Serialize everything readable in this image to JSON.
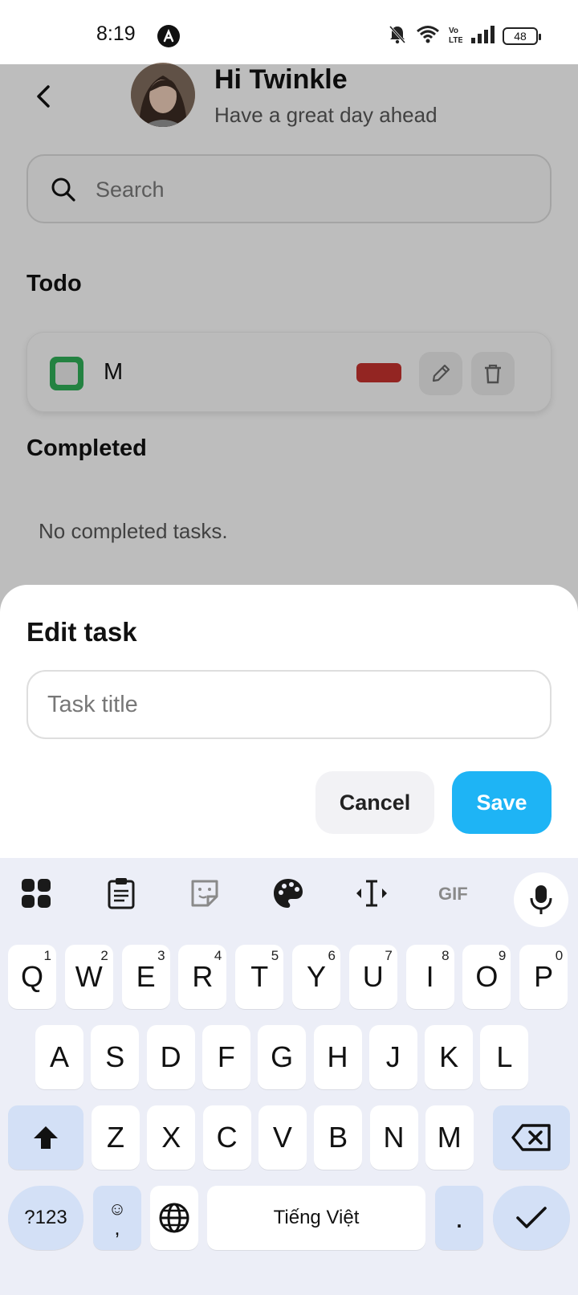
{
  "status_bar": {
    "time": "8:19",
    "battery": "48",
    "icons": [
      "app-logo-icon",
      "bell-off-icon",
      "wifi-icon",
      "volte-icon",
      "signal-icon",
      "battery-icon"
    ]
  },
  "header": {
    "greeting": "Hi Twinkle",
    "subtitle": "Have a great day ahead"
  },
  "search": {
    "placeholder": "Search"
  },
  "todo": {
    "section_title": "Todo",
    "tasks": [
      {
        "title": "M",
        "color": "#c0312d"
      }
    ]
  },
  "completed": {
    "section_title": "Completed",
    "empty_text": "No completed tasks."
  },
  "edit_sheet": {
    "title": "Edit task",
    "input_placeholder": "Task title",
    "input_value": "",
    "cancel_label": "Cancel",
    "save_label": "Save",
    "save_color": "#1eb4f5"
  },
  "keyboard": {
    "toolbar_icons": [
      "apps-grid-icon",
      "clipboard-icon",
      "sticker-icon",
      "palette-icon",
      "text-cursor-icon",
      "gif-icon",
      "mic-icon"
    ],
    "gif_label": "GIF",
    "row1": [
      {
        "k": "Q",
        "n": "1"
      },
      {
        "k": "W",
        "n": "2"
      },
      {
        "k": "E",
        "n": "3"
      },
      {
        "k": "R",
        "n": "4"
      },
      {
        "k": "T",
        "n": "5"
      },
      {
        "k": "Y",
        "n": "6"
      },
      {
        "k": "U",
        "n": "7"
      },
      {
        "k": "I",
        "n": "8"
      },
      {
        "k": "O",
        "n": "9"
      },
      {
        "k": "P",
        "n": "0"
      }
    ],
    "row2": [
      "A",
      "S",
      "D",
      "F",
      "G",
      "H",
      "J",
      "K",
      "L"
    ],
    "row3": [
      "Z",
      "X",
      "C",
      "V",
      "B",
      "N",
      "M"
    ],
    "symbols_label": "?123",
    "emoji_label": "☺",
    "comma_label": ",",
    "space_label": "Tiếng Việt",
    "period_label": "."
  }
}
